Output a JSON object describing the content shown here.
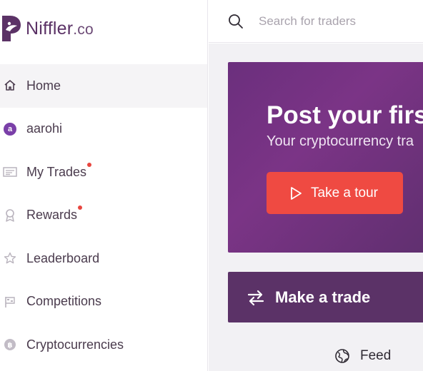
{
  "brand": {
    "name": "Niffler",
    "suffix": ".co"
  },
  "search": {
    "placeholder": "Search for traders",
    "value": ""
  },
  "sidebar": {
    "items": [
      {
        "label": "Home",
        "icon": "home-icon",
        "active": true,
        "badge": false
      },
      {
        "label": "aarohi",
        "icon": "avatar",
        "avatar_letter": "a",
        "active": false,
        "badge": false
      },
      {
        "label": "My Trades",
        "icon": "trades-icon",
        "active": false,
        "badge": true
      },
      {
        "label": "Rewards",
        "icon": "award-icon",
        "active": false,
        "badge": true
      },
      {
        "label": "Leaderboard",
        "icon": "star-icon",
        "active": false,
        "badge": false
      },
      {
        "label": "Competitions",
        "icon": "flag-icon",
        "active": false,
        "badge": false
      },
      {
        "label": "Cryptocurrencies",
        "icon": "crypto-coin-icon",
        "active": false,
        "badge": false
      }
    ]
  },
  "hero": {
    "title": "Post your firs",
    "subtitle": "Your cryptocurrency tra",
    "tour_label": "Take a tour"
  },
  "trade": {
    "label": "Make a trade"
  },
  "feed": {
    "label": "Feed"
  },
  "colors": {
    "brand": "#5b3266",
    "hero_gradient_start": "#6b2f7d",
    "tour_button": "#ef4a42",
    "trade_bar": "#5b3267",
    "badge_dot": "#e8463f"
  }
}
